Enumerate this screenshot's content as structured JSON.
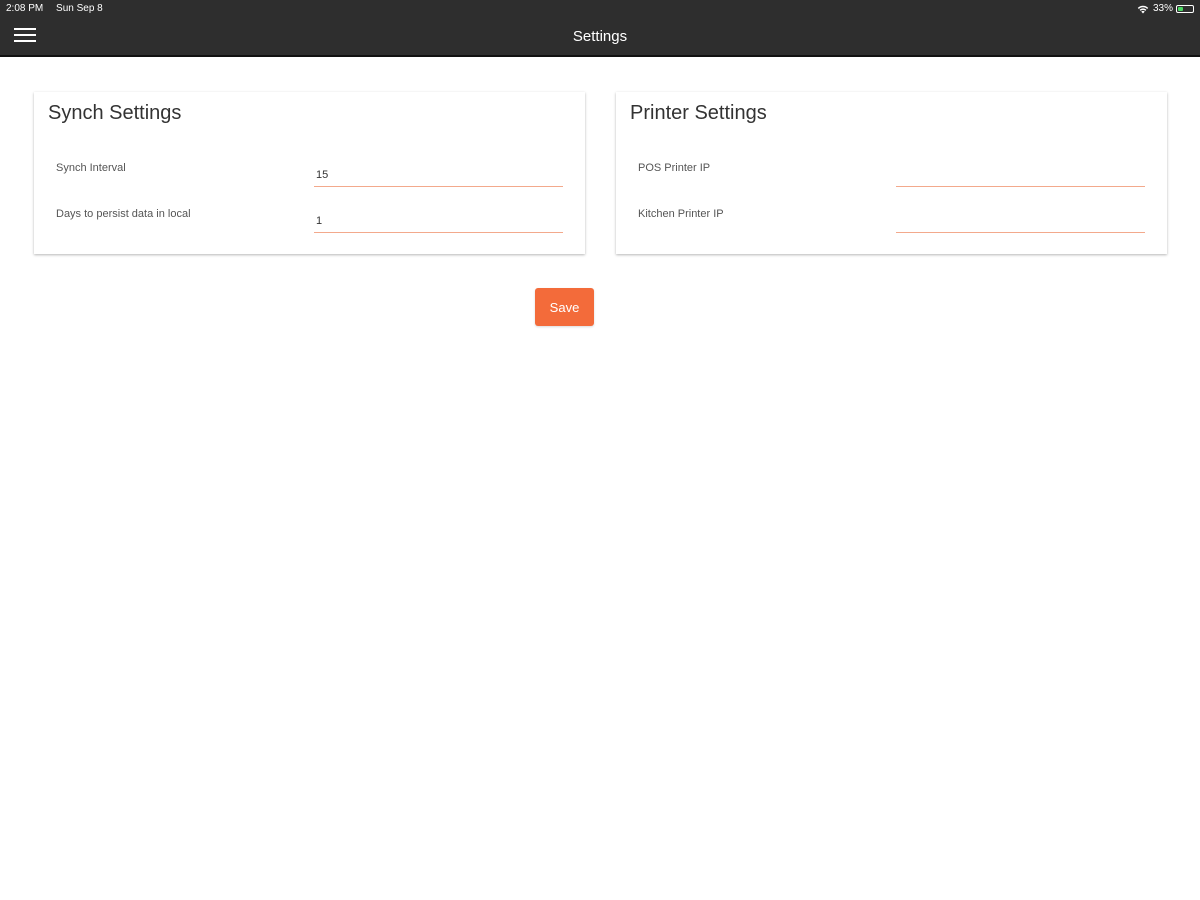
{
  "status_bar": {
    "time": "2:08 PM",
    "date": "Sun Sep 8",
    "battery_text": "33%",
    "battery_level": 0.33,
    "wifi_icon": "wifi-icon",
    "battery_icon": "battery-icon"
  },
  "nav": {
    "title": "Settings",
    "menu_icon": "hamburger-menu-icon"
  },
  "synch_settings": {
    "title": "Synch Settings",
    "fields": [
      {
        "label": "Synch Interval",
        "value": "15"
      },
      {
        "label": "Days to persist data in local",
        "value": "1"
      }
    ]
  },
  "printer_settings": {
    "title": "Printer Settings",
    "fields": [
      {
        "label": "POS Printer IP",
        "value": ""
      },
      {
        "label": "Kitchen Printer IP",
        "value": ""
      }
    ]
  },
  "actions": {
    "save_label": "Save"
  },
  "colors": {
    "accent": "#f36b3a",
    "nav_background": "#2e2e2e",
    "input_underline": "#f3a98c",
    "battery_green": "#4cd964"
  }
}
